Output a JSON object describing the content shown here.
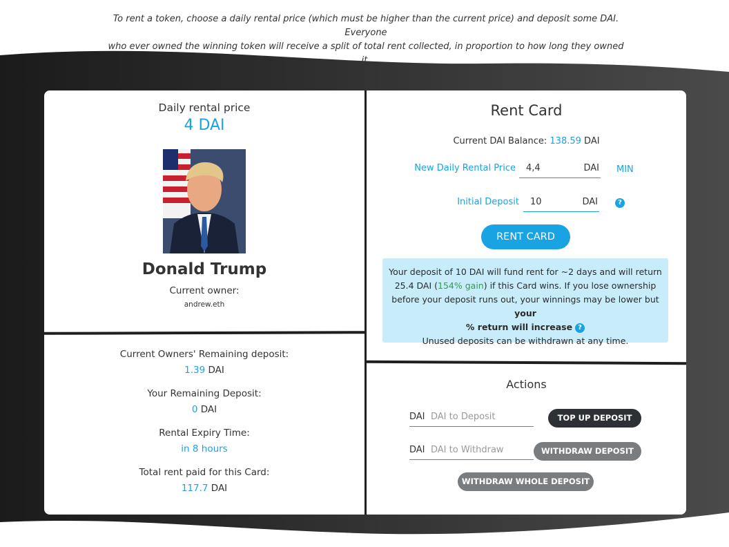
{
  "intro": {
    "line1": "To rent a token, choose a daily rental price (which must be higher than the current price) and deposit some DAI. Everyone",
    "line2": "who ever owned the winning token will receive a split of total rent collected, in proportion to how long they owned it."
  },
  "token": {
    "price_label": "Daily rental price",
    "price_value": "4 DAI",
    "name": "Donald Trump",
    "owner_label": "Current owner:",
    "owner_value": "andrew.eth"
  },
  "stats": {
    "owner_deposit_label": "Current Owners' Remaining deposit:",
    "owner_deposit_value": "1.39",
    "your_deposit_label": "Your Remaining Deposit:",
    "your_deposit_value": "0",
    "expiry_label": "Rental Expiry Time:",
    "expiry_value": "in 8 hours",
    "total_rent_label": "Total rent paid for this Card:",
    "total_rent_value": "117.7",
    "unit": "DAI"
  },
  "rent": {
    "title": "Rent Card",
    "balance_label": "Current DAI Balance:",
    "balance_value": "138.59",
    "balance_unit": "DAI",
    "price_field_label": "New Daily Rental Price",
    "price_field_value": "4,4",
    "price_field_unit": "DAI",
    "min_label": "MIN",
    "deposit_field_label": "Initial Deposit",
    "deposit_field_value": "10",
    "deposit_field_unit": "DAI",
    "button": "RENT CARD",
    "info": {
      "part1": "Your deposit of 10 DAI will fund rent for ~2 days and will return",
      "part2": "25.4 DAI (",
      "gain": "154% gain",
      "part3": ") if this Card wins. If you lose ownership",
      "part4": "before your deposit runs out, your winnings may be lower but",
      "bold1": "your",
      "bold2": "% return will increase",
      "part5": "Unused deposits can be withdrawn at any time."
    }
  },
  "actions": {
    "title": "Actions",
    "deposit_unit": "DAI",
    "deposit_placeholder": "DAI to Deposit",
    "topup_button": "TOP UP DEPOSIT",
    "withdraw_unit": "DAI",
    "withdraw_placeholder": "DAI to Withdraw",
    "withdraw_button": "WITHDRAW DEPOSIT",
    "withdraw_all_button": "WITHDRAW WHOLE DEPOSIT"
  },
  "colors": {
    "accent": "#1aa3e3",
    "gain": "#2ea043",
    "dark_button": "#2d3136",
    "grey_button": "#7a7d80",
    "info_bg": "#c9ecfa"
  },
  "icons": [
    "question-icon"
  ]
}
